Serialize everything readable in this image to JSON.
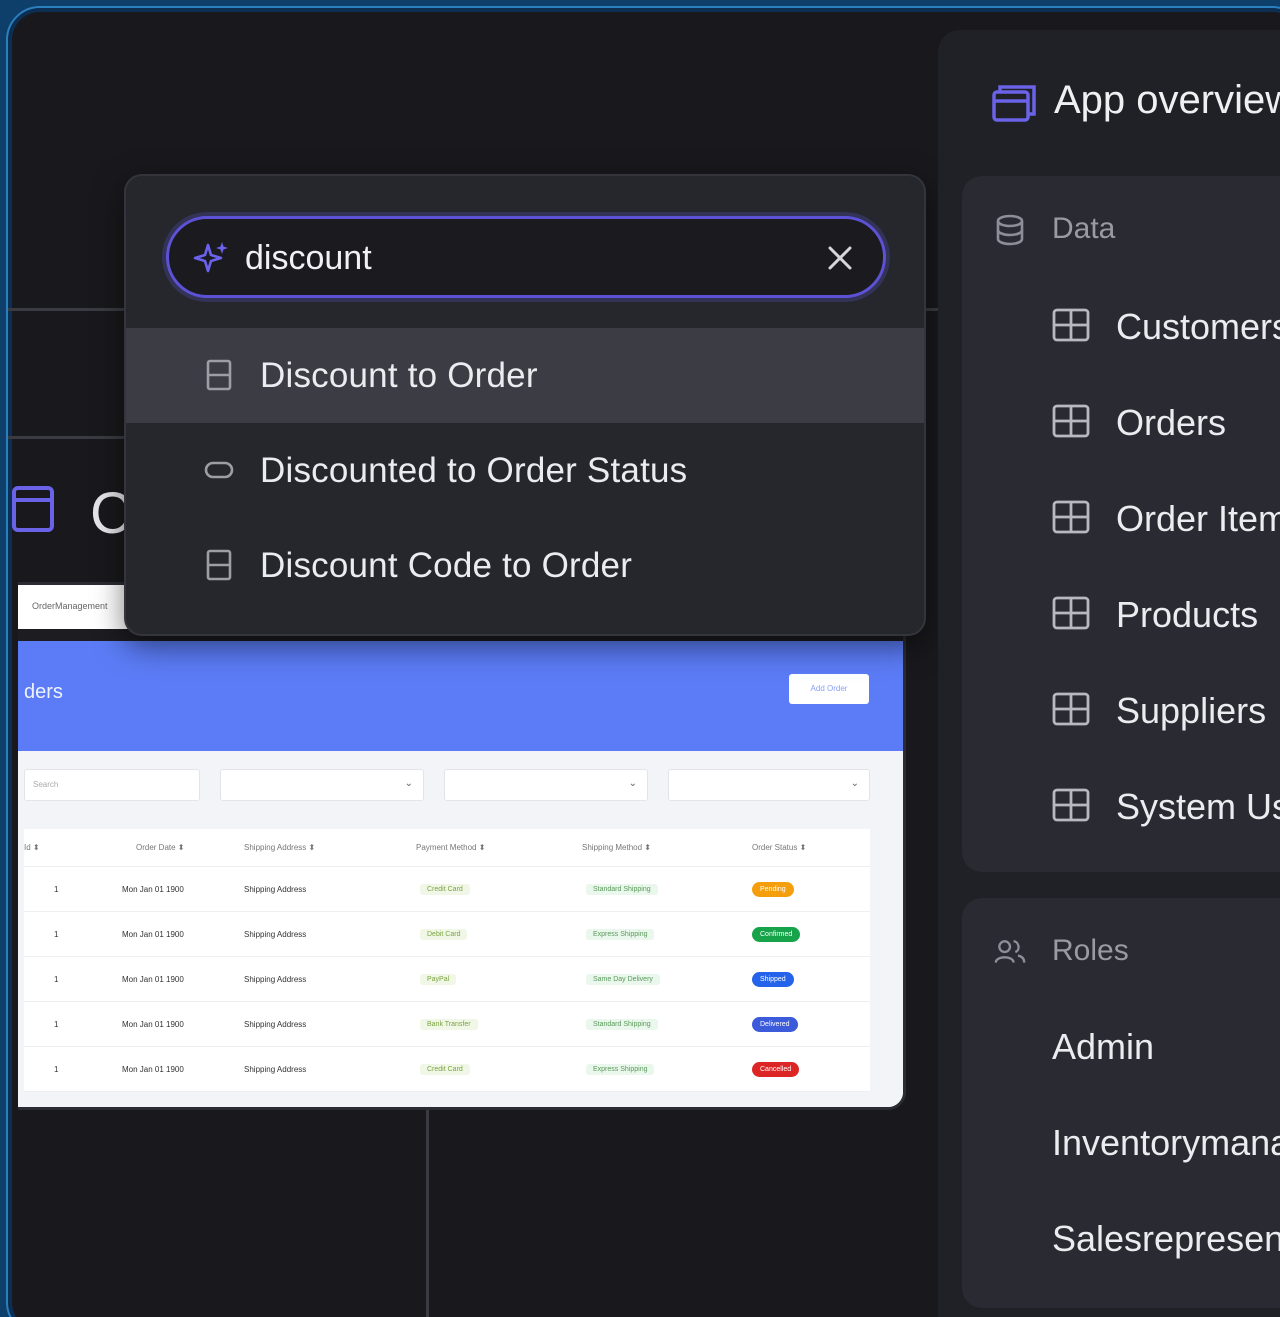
{
  "search": {
    "query": "discount",
    "results": [
      {
        "label": "Discount to Order",
        "icon": "relation-icon",
        "active": true
      },
      {
        "label": "Discounted to Order Status",
        "icon": "choice-icon",
        "active": false
      },
      {
        "label": "Discount Code to Order",
        "icon": "relation-icon",
        "active": false
      }
    ]
  },
  "background_card": {
    "letter": "C"
  },
  "preview": {
    "tab": "OrderManagement",
    "title": "ders",
    "add_button": "Add Order",
    "search_placeholder": "Search",
    "columns": [
      "Id",
      "Order Date",
      "Shipping Address",
      "Payment Method",
      "Shipping Method",
      "Order Status"
    ],
    "rows": [
      [
        "1",
        "Mon Jan 01 1900",
        "Shipping Address",
        "Credit Card",
        "Standard Shipping",
        "Pending"
      ],
      [
        "1",
        "Mon Jan 01 1900",
        "Shipping Address",
        "Debit Card",
        "Express Shipping",
        "Confirmed"
      ],
      [
        "1",
        "Mon Jan 01 1900",
        "Shipping Address",
        "PayPal",
        "Same Day Delivery",
        "Shipped"
      ],
      [
        "1",
        "Mon Jan 01 1900",
        "Shipping Address",
        "Bank Transfer",
        "Standard Shipping",
        "Delivered"
      ],
      [
        "1",
        "Mon Jan 01 1900",
        "Shipping Address",
        "Credit Card",
        "Express Shipping",
        "Cancelled"
      ]
    ],
    "status_colors": {
      "Pending": "#f59e0b",
      "Confirmed": "#16a34a",
      "Shipped": "#2563eb",
      "Delivered": "#3b5bdb",
      "Cancelled": "#dc2626"
    }
  },
  "panel": {
    "title": "App overview",
    "data_section": {
      "title": "Data",
      "items": [
        "Customers",
        "Orders",
        "Order Items",
        "Products",
        "Suppliers",
        "System Users"
      ]
    },
    "roles_section": {
      "title": "Roles",
      "items": [
        "Admin",
        "Inventorymanager",
        "Salesrepresentative"
      ]
    }
  },
  "colors": {
    "accent": "#5d52d6",
    "background": "#19191d",
    "panel": "#202127",
    "preview_header": "#5b7cf6"
  }
}
